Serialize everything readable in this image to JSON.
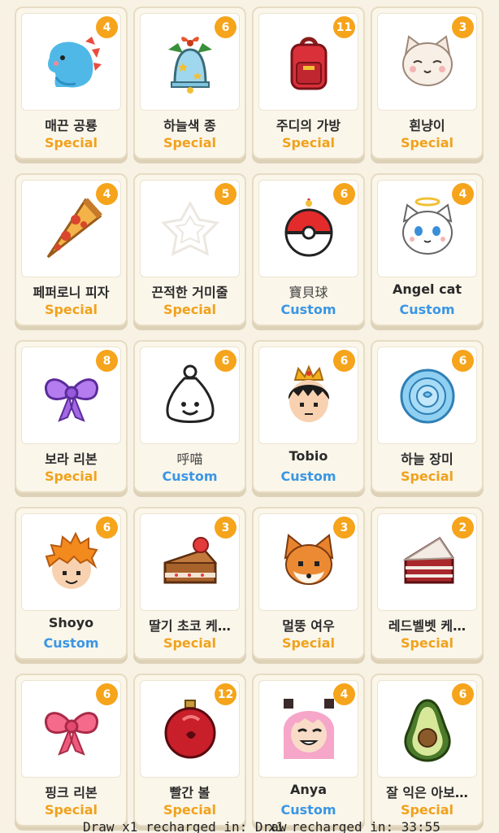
{
  "items": [
    {
      "name": "매끈 공룡",
      "tag": "Special",
      "count": "4",
      "icon": "blue-dinosaur-icon"
    },
    {
      "name": "하늘색 종",
      "tag": "Special",
      "count": "6",
      "icon": "sky-blue-bell-icon"
    },
    {
      "name": "주디의 가방",
      "tag": "Special",
      "count": "11",
      "icon": "red-backpack-icon"
    },
    {
      "name": "흰냥이",
      "tag": "Special",
      "count": "3",
      "icon": "white-cat-icon"
    },
    {
      "name": "페퍼로니 피자",
      "tag": "Special",
      "count": "4",
      "icon": "pizza-slice-icon"
    },
    {
      "name": "끈적한 거미줄",
      "tag": "Special",
      "count": "5",
      "icon": "spider-web-icon"
    },
    {
      "name": "寶貝球",
      "tag": "Custom",
      "count": "6",
      "icon": "pokeball-icon"
    },
    {
      "name": "Angel cat",
      "tag": "Custom",
      "count": "4",
      "icon": "angel-cat-icon"
    },
    {
      "name": "보라 리본",
      "tag": "Special",
      "count": "8",
      "icon": "purple-ribbon-icon"
    },
    {
      "name": "呼喵",
      "tag": "Custom",
      "count": "6",
      "icon": "smiling-bag-icon"
    },
    {
      "name": "Tobio",
      "tag": "Custom",
      "count": "6",
      "icon": "crowned-boy-icon"
    },
    {
      "name": "하늘 장미",
      "tag": "Special",
      "count": "6",
      "icon": "blue-rose-icon"
    },
    {
      "name": "Shoyo",
      "tag": "Custom",
      "count": "6",
      "icon": "orange-hair-boy-icon"
    },
    {
      "name": "딸기 초코 케…",
      "tag": "Special",
      "count": "3",
      "icon": "strawberry-choco-cake-icon"
    },
    {
      "name": "멀뚱 여우",
      "tag": "Special",
      "count": "3",
      "icon": "fox-icon"
    },
    {
      "name": "레드벨벳 케…",
      "tag": "Special",
      "count": "2",
      "icon": "red-velvet-cake-icon"
    },
    {
      "name": "핑크 리본",
      "tag": "Special",
      "count": "6",
      "icon": "pink-ribbon-icon"
    },
    {
      "name": "빨간 볼",
      "tag": "Special",
      "count": "12",
      "icon": "red-ornament-icon"
    },
    {
      "name": "Anya",
      "tag": "Custom",
      "count": "4",
      "icon": "anya-face-icon"
    },
    {
      "name": "잘 익은 아보…",
      "tag": "Special",
      "count": "6",
      "icon": "avocado-icon"
    }
  ],
  "footer": {
    "text1": "Draw x1 recharged in: Draw",
    "text2": "x1 recharged in: 33:55"
  },
  "colors": {
    "special": "#f0a21c",
    "custom": "#3a96e4",
    "badge": "#f5a41b",
    "background": "#f7f2e4"
  }
}
